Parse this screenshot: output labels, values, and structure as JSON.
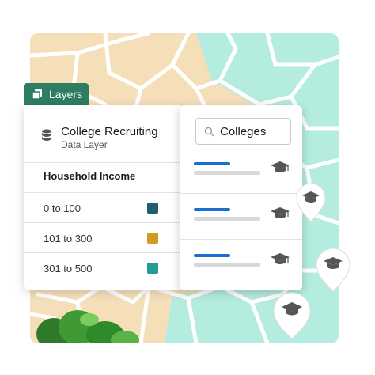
{
  "layers_tab": {
    "label": "Layers",
    "icon": "layers-icon"
  },
  "layer_card": {
    "title": "College Recruiting",
    "subtitle": "Data Layer",
    "icon": "database-icon",
    "section_title": "Household Income",
    "legend": [
      {
        "label": "0 to 100",
        "color": "#1f5f6e"
      },
      {
        "label": "101 to 300",
        "color": "#d19a22"
      },
      {
        "label": "301 to 500",
        "color": "#1f9e96"
      }
    ]
  },
  "results_card": {
    "search_value": "Colleges",
    "search_icon": "search-icon",
    "result_icon": "graduation-cap-icon",
    "result_count": 3
  },
  "map": {
    "colors": {
      "residential": "#f4dfb8",
      "water": "#b5ece0",
      "road": "#ffffff"
    },
    "pin_icon": "map-pin-icon"
  }
}
